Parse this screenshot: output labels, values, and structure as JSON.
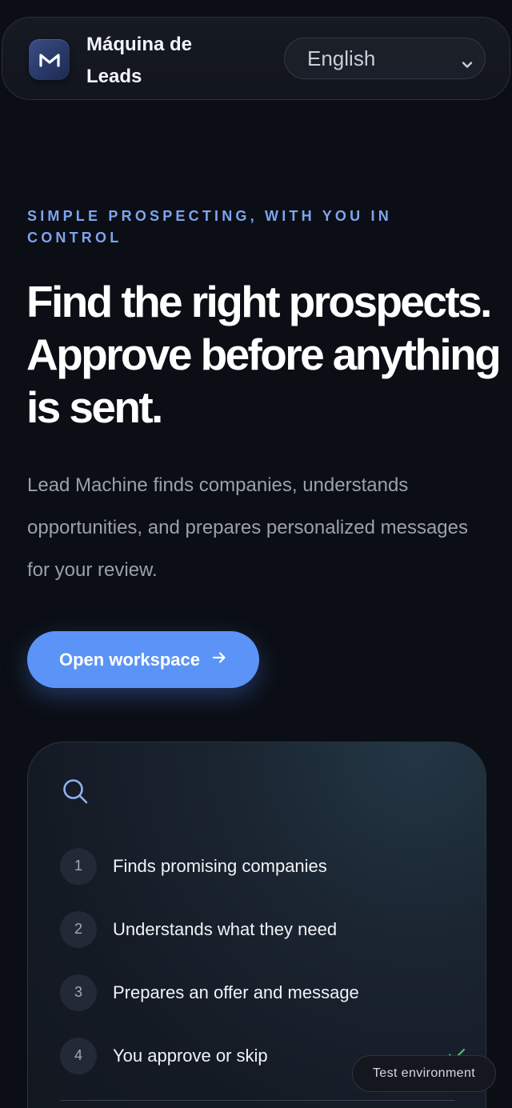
{
  "header": {
    "brand": "Máquina de Leads",
    "language": "English"
  },
  "hero": {
    "eyebrow": "SIMPLE PROSPECTING, WITH YOU IN CONTROL",
    "headline": "Find the right prospects. Approve before anything is sent.",
    "lede": "Lead Machine finds companies, understands opportunities, and prepares personalized messages for your review.",
    "cta": "Open workspace"
  },
  "card": {
    "steps": [
      {
        "number": "1",
        "label": "Finds promising companies"
      },
      {
        "number": "2",
        "label": "Understands what they need"
      },
      {
        "number": "3",
        "label": "Prepares an offer and message"
      },
      {
        "number": "4",
        "label": "You approve or skip"
      }
    ]
  },
  "badge": "Test environment",
  "colors": {
    "accent": "#5b94f6",
    "eyebrow": "#7ea4f0",
    "background": "#0b0e14",
    "check": "#4fbf73"
  },
  "icons": {
    "logo": "logo-m-icon",
    "language_chevron": "chevron-down-icon",
    "cta_arrow": "arrow-right-icon",
    "card_search": "search-icon",
    "approved": "check-icon"
  }
}
